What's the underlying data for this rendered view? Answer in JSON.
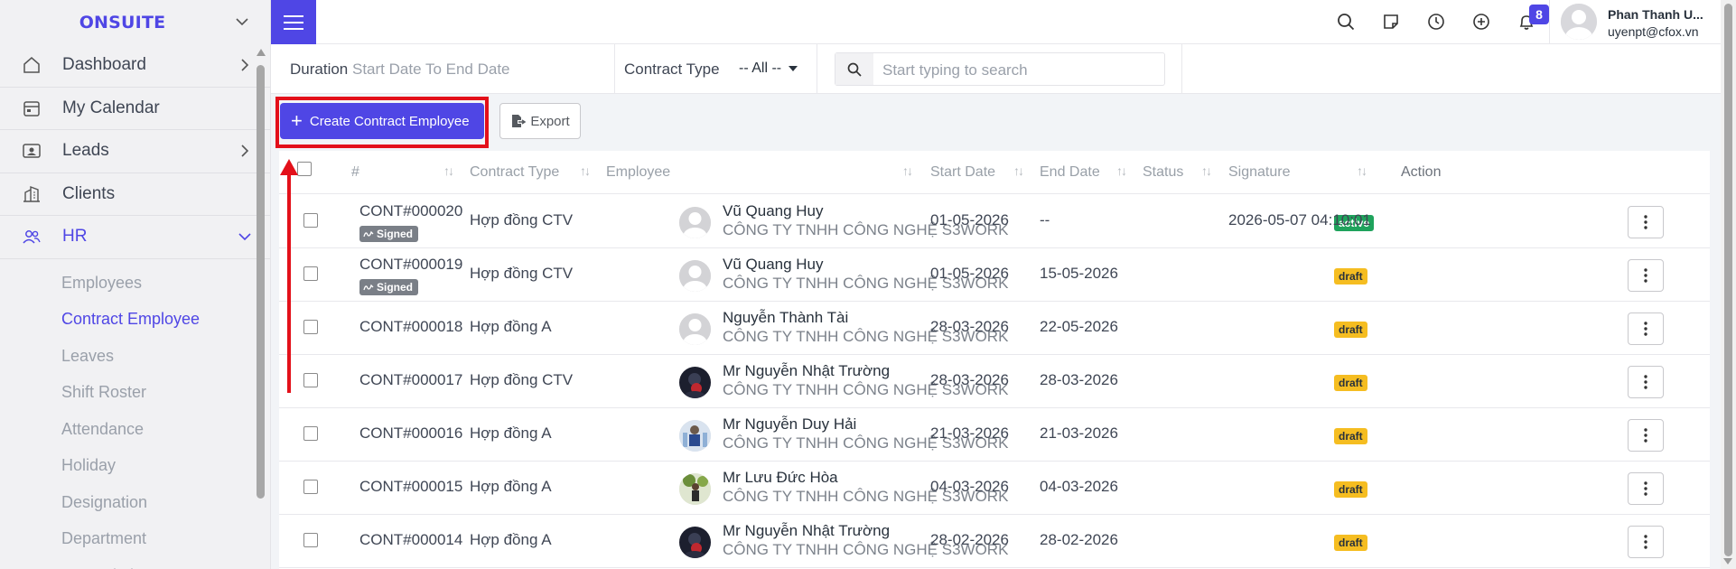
{
  "app": {
    "brand": "ONSUITE"
  },
  "sidebar": {
    "items": [
      {
        "label": "Dashboard",
        "icon": "home-icon",
        "has_chevron": true
      },
      {
        "label": "My Calendar",
        "icon": "calendar-icon",
        "has_chevron": false
      },
      {
        "label": "Leads",
        "icon": "contact-card-icon",
        "has_chevron": true
      },
      {
        "label": "Clients",
        "icon": "building-icon",
        "has_chevron": false
      },
      {
        "label": "HR",
        "icon": "users-icon",
        "has_chevron": true,
        "expanded": true
      }
    ],
    "hr_sub": [
      "Employees",
      "Contract Employee",
      "Leaves",
      "Shift Roster",
      "Attendance",
      "Holiday",
      "Designation",
      "Department",
      "Appreciation"
    ],
    "active_sub": "Contract Employee"
  },
  "topbar": {
    "notifications_count": "8",
    "user_name": "Phan Thanh U...",
    "user_email": "uyenpt@cfox.vn"
  },
  "filters": {
    "duration_label": "Duration",
    "duration_value": "Start Date To End Date",
    "contract_type_label": "Contract Type",
    "contract_type_value": "-- All --",
    "search_placeholder": "Start typing to search"
  },
  "actions": {
    "create_label": "Create Contract Employee",
    "export_label": "Export"
  },
  "table": {
    "columns": [
      "#",
      "Contract Type",
      "Employee",
      "Start Date",
      "End Date",
      "Status",
      "Signature",
      "Action"
    ],
    "rows": [
      {
        "id": "CONT#000020",
        "signed": "Signed",
        "type": "Hợp đồng CTV",
        "name": "Vũ Quang Huy",
        "company": "CÔNG TY TNHH CÔNG NGHỆ S3WORK",
        "start": "01-05-2026",
        "end": "--",
        "status": "active",
        "signature": "2026-05-07 04:10:01",
        "avatar": "default"
      },
      {
        "id": "CONT#000019",
        "signed": "Signed",
        "type": "Hợp đồng CTV",
        "name": "Vũ Quang Huy",
        "company": "CÔNG TY TNHH CÔNG NGHỆ S3WORK",
        "start": "01-05-2026",
        "end": "15-05-2026",
        "status": "draft",
        "signature": "",
        "avatar": "default"
      },
      {
        "id": "CONT#000018",
        "signed": "",
        "type": "Hợp đồng A",
        "name": "Nguyễn Thành Tài",
        "company": "CÔNG TY TNHH CÔNG NGHỆ S3WORK",
        "start": "28-03-2026",
        "end": "22-05-2026",
        "status": "draft",
        "signature": "",
        "avatar": "default"
      },
      {
        "id": "CONT#000017",
        "signed": "",
        "type": "Hợp đồng CTV",
        "name": "Mr Nguyễn Nhật Trường",
        "company": "CÔNG TY TNHH CÔNG NGHỆ S3WORK",
        "start": "28-03-2026",
        "end": "28-03-2026",
        "status": "draft",
        "signature": "",
        "avatar": "photo-dark"
      },
      {
        "id": "CONT#000016",
        "signed": "",
        "type": "Hợp đồng A",
        "name": "Mr Nguyễn Duy Hải",
        "company": "CÔNG TY TNHH CÔNG NGHỆ S3WORK",
        "start": "21-03-2026",
        "end": "21-03-2026",
        "status": "draft",
        "signature": "",
        "avatar": "photo-blue"
      },
      {
        "id": "CONT#000015",
        "signed": "",
        "type": "Hợp đồng A",
        "name": "Mr Lưu Đức Hòa",
        "company": "CÔNG TY TNHH CÔNG NGHỆ S3WORK",
        "start": "04-03-2026",
        "end": "04-03-2026",
        "status": "draft",
        "signature": "",
        "avatar": "photo-green"
      },
      {
        "id": "CONT#000014",
        "signed": "",
        "type": "Hợp đồng A",
        "name": "Mr Nguyễn Nhật Trường",
        "company": "CÔNG TY TNHH CÔNG NGHỆ S3WORK",
        "start": "28-02-2026",
        "end": "28-02-2026",
        "status": "draft",
        "signature": "",
        "avatar": "photo-dark"
      }
    ]
  },
  "colors": {
    "accent": "#4f46e5",
    "highlight": "#e3101a",
    "active": "#1fa35c",
    "draft": "#f5bd21"
  }
}
